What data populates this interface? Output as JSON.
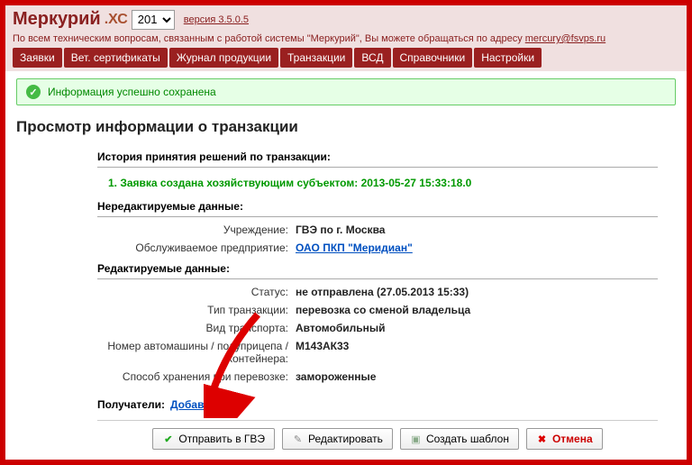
{
  "header": {
    "logo_main": "Меркурий",
    "logo_sub": ".ХС",
    "year_value": "201",
    "version": "версия 3.5.0.5"
  },
  "sub_header": {
    "text": "По всем техническим вопросам, связанным с работой системы \"Меркурий\", Вы можете обращаться по адресу ",
    "email": "mercury@fsvps.ru"
  },
  "tabs": {
    "t0": "Заявки",
    "t1": "Вет. сертификаты",
    "t2": "Журнал продукции",
    "t3": "Транзакции",
    "t4": "ВСД",
    "t5": "Справочники",
    "t6": "Настройки"
  },
  "success_message": "Информация успешно сохранена",
  "page_title": "Просмотр информации о транзакции",
  "sections": {
    "history_title": "История принятия решений по транзакции:",
    "history_item": "1. Заявка создана хозяйствующим субъектом: 2013-05-27 15:33:18.0",
    "noneditable_title": "Нередактируемые данные:",
    "editable_title": "Редактируемые данные:"
  },
  "noneditable": {
    "institution_label": "Учреждение:",
    "institution_value": "ГВЭ по г. Москва",
    "enterprise_label": "Обслуживаемое предприятие:",
    "enterprise_value": "ОАО ПКП \"Меридиан\""
  },
  "editable": {
    "status_label": "Статус:",
    "status_value": "не отправлена (27.05.2013 15:33)",
    "type_label": "Тип транзакции:",
    "type_value": "перевозка со сменой владельца",
    "transport_label": "Вид транспорта:",
    "transport_value": "Автомобильный",
    "vehicle_label": "Номер автомашины / полуприцепа / контейнера:",
    "vehicle_value": "М143АК33",
    "storage_label": "Способ хранения при перевозке:",
    "storage_value": "замороженные"
  },
  "recipients": {
    "label": "Получатели:",
    "add": "Добавить"
  },
  "buttons": {
    "send": "Отправить в ГВЭ",
    "edit": "Редактировать",
    "template": "Создать шаблон",
    "cancel": "Отмена"
  }
}
